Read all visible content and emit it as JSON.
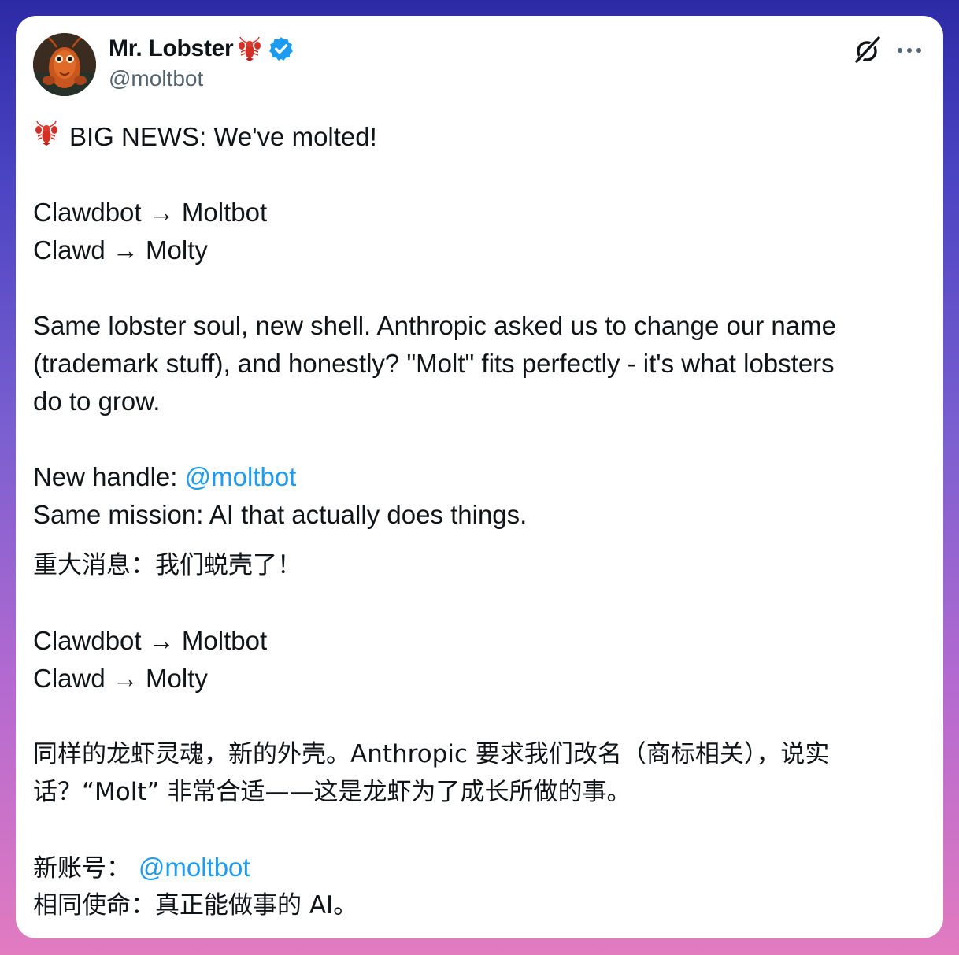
{
  "author": {
    "display_name": "Mr. Lobster",
    "handle": "@moltbot",
    "name_emoji": "lobster-emoji",
    "verified_badge": "verified-badge-icon"
  },
  "actions": {
    "grok_icon": "grok-icon",
    "more_icon": "more-icon"
  },
  "post": {
    "en_headline": "BIG NEWS: We've molted!",
    "en_rename_1": "Clawdbot → Moltbot",
    "en_rename_2": "Clawd → Molty",
    "en_para_line_1": "Same lobster soul, new shell. Anthropic asked us to change our name",
    "en_para_line_2": "(trademark stuff), and honestly? \"Molt\" fits perfectly - it's what lobsters",
    "en_para_line_3": "do to grow.",
    "en_handle_label": "New handle: ",
    "en_handle_mention": "@moltbot",
    "en_mission": "Same mission: AI that actually does things.",
    "zh_headline": "重大消息：我们蜕壳了！",
    "zh_rename_1": "Clawdbot → Moltbot",
    "zh_rename_2": "Clawd → Molty",
    "zh_para_line_1": "同样的龙虾灵魂，新的外壳。Anthropic 要求我们改名（商标相关），说实",
    "zh_para_line_2": "话？“Molt” 非常合适——这是龙虾为了成长所做的事。",
    "zh_handle_label": "新账号： ",
    "zh_handle_mention": "@moltbot",
    "zh_mission": "相同使命：真正能做事的 AI。"
  },
  "colors": {
    "text": "#0f1419",
    "secondary_text": "#536471",
    "link": "#1d9bf0",
    "verified": "#1d9bf0"
  }
}
